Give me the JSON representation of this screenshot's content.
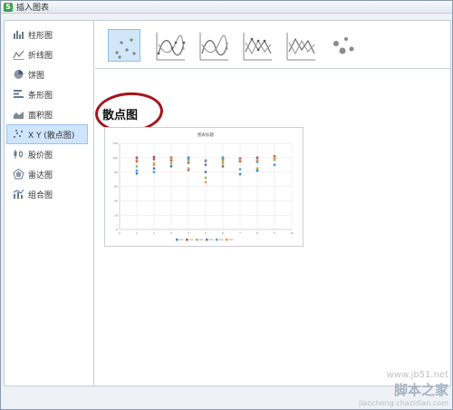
{
  "window": {
    "title": "插入图表",
    "app_icon": "S"
  },
  "sidebar": {
    "items": [
      {
        "label": "柱形图",
        "icon": "column-chart-icon"
      },
      {
        "label": "折线图",
        "icon": "line-chart-icon"
      },
      {
        "label": "饼图",
        "icon": "pie-chart-icon"
      },
      {
        "label": "条形图",
        "icon": "bar-chart-icon"
      },
      {
        "label": "面积图",
        "icon": "area-chart-icon"
      },
      {
        "label": "X Y (散点图)",
        "icon": "scatter-chart-icon",
        "selected": true
      },
      {
        "label": "股价图",
        "icon": "stock-chart-icon"
      },
      {
        "label": "雷达图",
        "icon": "radar-chart-icon"
      },
      {
        "label": "组合图",
        "icon": "combo-chart-icon"
      }
    ]
  },
  "subtypes": [
    {
      "name": "scatter-markers",
      "selected": true
    },
    {
      "name": "scatter-smooth-lines-markers"
    },
    {
      "name": "scatter-smooth-lines"
    },
    {
      "name": "scatter-straight-lines-markers"
    },
    {
      "name": "scatter-straight-lines"
    },
    {
      "name": "bubble"
    }
  ],
  "heading": "散点图",
  "annotation_color": "#a4141a",
  "accent_color": "#cfe5fb",
  "watermark": {
    "line1": "www.jb51.net",
    "line2": "脚本之家",
    "line3": "jiaocheng.chazidian.com"
  },
  "chart_data": {
    "type": "scatter",
    "title": "图表标题",
    "xlim": [
      0,
      10
    ],
    "ylim": [
      0,
      120
    ],
    "xticks": [
      "0",
      "1",
      "2",
      "3",
      "4",
      "5",
      "6",
      "7",
      "8",
      "9",
      "10"
    ],
    "yticks": [
      "0",
      "20",
      "40",
      "60",
      "80",
      "100",
      "120"
    ],
    "series": [
      {
        "color": "#4f81bd",
        "x": [
          1,
          2,
          3,
          4,
          5,
          6,
          7,
          8,
          9
        ],
        "y": [
          78,
          85,
          88,
          83,
          80,
          88,
          77,
          82,
          90
        ]
      },
      {
        "color": "#c0504d",
        "x": [
          1,
          2,
          3,
          4,
          5,
          6,
          7,
          8,
          9
        ],
        "y": [
          95,
          98,
          96,
          93,
          96,
          98,
          95,
          96,
          99
        ]
      },
      {
        "color": "#9bbb59",
        "x": [
          1,
          2,
          3,
          4,
          5,
          6,
          7,
          8,
          9
        ],
        "y": [
          88,
          90,
          92,
          95,
          72,
          95,
          99,
          85,
          97
        ]
      },
      {
        "color": "#8064a2",
        "x": [
          1,
          2,
          3,
          4,
          5,
          6,
          7,
          8,
          9
        ],
        "y": [
          100,
          101,
          100,
          100,
          90,
          100,
          99,
          100,
          102
        ]
      },
      {
        "color": "#4bacc6",
        "x": [
          1,
          2,
          3,
          4,
          5,
          6,
          7,
          8,
          9
        ],
        "y": [
          82,
          80,
          99,
          98,
          95,
          99,
          84,
          94,
          90
        ]
      },
      {
        "color": "#f79646",
        "x": [
          1,
          2,
          3,
          4,
          5,
          6,
          7,
          8,
          9
        ],
        "y": [
          97,
          92,
          98,
          85,
          66,
          92,
          97,
          97,
          100
        ]
      }
    ]
  }
}
